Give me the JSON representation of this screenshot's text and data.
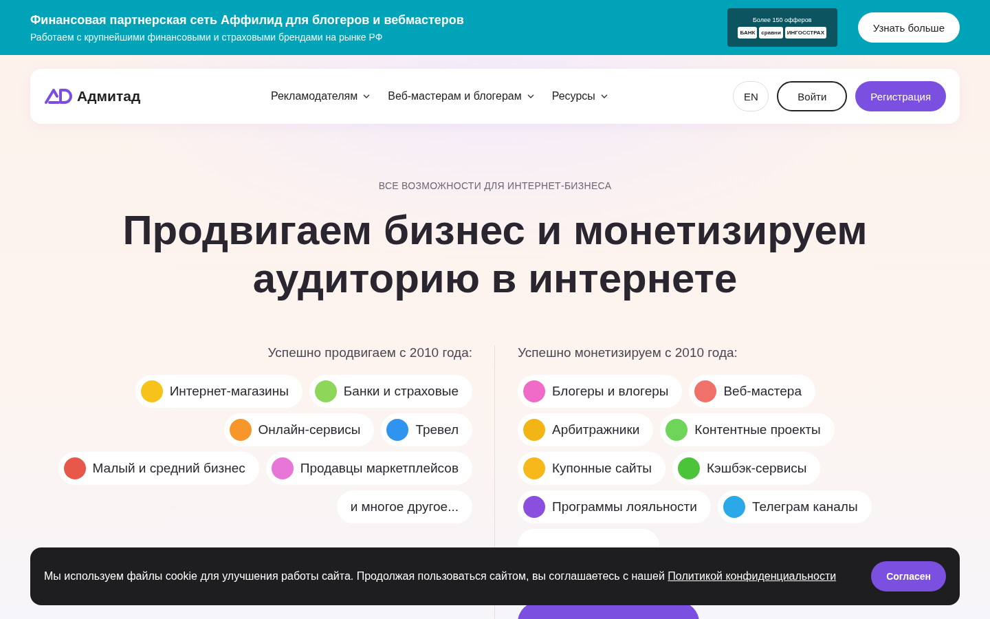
{
  "promo_bar": {
    "title": "Финансовая партнерская сеть Аффилид для блогеров и вебмастеров",
    "subtitle": "Работаем с крупнейшими финансовыми и страховыми брендами на рынке РФ",
    "offers_badge": {
      "caption": "Более 150 офферов",
      "logos": [
        "БАНК",
        "сравни",
        "ИНГОССТРАХ"
      ]
    },
    "button": "Узнать больше"
  },
  "header": {
    "logo": "Адмитад",
    "nav": [
      "Рекламодателям",
      "Веб-мастерам и блогерам",
      "Ресурсы"
    ],
    "language": "EN",
    "login": "Войти",
    "register": "Регистрация"
  },
  "hero": {
    "eyebrow": "ВСЕ ВОЗМОЖНОСТИ ДЛЯ ИНТЕРНЕТ-БИЗНЕСА",
    "title": "Продвигаем бизнес и монетизируем аудиторию в интернете"
  },
  "columns": [
    {
      "heading": "Успешно продвигаем с 2010 года:",
      "rows": [
        [
          {
            "kind": "chip",
            "label": "Интернет-магазины",
            "color": "#f7c21a"
          },
          {
            "kind": "chip",
            "label": "Банки и страховые",
            "color": "#8ed65a"
          }
        ],
        [
          {
            "kind": "chip",
            "label": "Онлайн-сервисы",
            "color": "#f7962a"
          },
          {
            "kind": "chip",
            "label": "Тревел",
            "color": "#2f93f0"
          }
        ],
        [
          {
            "kind": "chip",
            "label": "Малый и средний бизнес",
            "color": "#e8584a"
          },
          {
            "kind": "chip",
            "label": "Продавцы маркетплейсов",
            "color": "#e876d8"
          }
        ]
      ],
      "more": {
        "kind": "text",
        "label": "и многое другое..."
      }
    },
    {
      "heading": "Успешно монетизируем с 2010 года:",
      "rows": [
        [
          {
            "kind": "chip",
            "label": "Блогеры и влогеры",
            "color": "#f06ac8"
          },
          {
            "kind": "chip",
            "label": "Веб-мастера",
            "color": "#f0706a"
          }
        ],
        [
          {
            "kind": "chip",
            "label": "Арбитражники",
            "color": "#f2b515"
          },
          {
            "kind": "chip",
            "label": "Контентные проекты",
            "color": "#6fd45a"
          }
        ],
        [
          {
            "kind": "chip",
            "label": "Купонные сайты",
            "color": "#f7b81c"
          },
          {
            "kind": "chip",
            "label": "Кэшбэк-сервисы",
            "color": "#4cc43a"
          }
        ],
        [
          {
            "kind": "chip",
            "label": "Программы лояльности",
            "color": "#8b4fe0"
          },
          {
            "kind": "chip",
            "label": "Телеграм каналы",
            "color": "#2aa8e8"
          }
        ]
      ],
      "more": {
        "kind": "covered"
      }
    }
  ],
  "cookie_banner": {
    "text": "Мы используем файлы cookie для улучшения работы сайта. Продолжая пользоваться сайтом, вы соглашаетесь с нашей ",
    "link": "Политикой конфиденциальности",
    "button": "Согласен"
  }
}
